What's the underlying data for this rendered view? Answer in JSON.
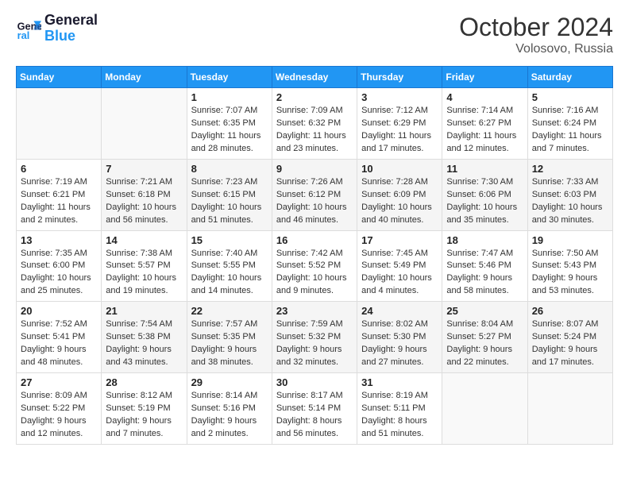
{
  "header": {
    "logo_line1": "General",
    "logo_line2": "Blue",
    "month": "October 2024",
    "location": "Volosovo, Russia"
  },
  "days_of_week": [
    "Sunday",
    "Monday",
    "Tuesday",
    "Wednesday",
    "Thursday",
    "Friday",
    "Saturday"
  ],
  "weeks": [
    {
      "days": [
        {
          "num": "",
          "info": ""
        },
        {
          "num": "",
          "info": ""
        },
        {
          "num": "1",
          "info": "Sunrise: 7:07 AM\nSunset: 6:35 PM\nDaylight: 11 hours and 28 minutes."
        },
        {
          "num": "2",
          "info": "Sunrise: 7:09 AM\nSunset: 6:32 PM\nDaylight: 11 hours and 23 minutes."
        },
        {
          "num": "3",
          "info": "Sunrise: 7:12 AM\nSunset: 6:29 PM\nDaylight: 11 hours and 17 minutes."
        },
        {
          "num": "4",
          "info": "Sunrise: 7:14 AM\nSunset: 6:27 PM\nDaylight: 11 hours and 12 minutes."
        },
        {
          "num": "5",
          "info": "Sunrise: 7:16 AM\nSunset: 6:24 PM\nDaylight: 11 hours and 7 minutes."
        }
      ]
    },
    {
      "days": [
        {
          "num": "6",
          "info": "Sunrise: 7:19 AM\nSunset: 6:21 PM\nDaylight: 11 hours and 2 minutes."
        },
        {
          "num": "7",
          "info": "Sunrise: 7:21 AM\nSunset: 6:18 PM\nDaylight: 10 hours and 56 minutes."
        },
        {
          "num": "8",
          "info": "Sunrise: 7:23 AM\nSunset: 6:15 PM\nDaylight: 10 hours and 51 minutes."
        },
        {
          "num": "9",
          "info": "Sunrise: 7:26 AM\nSunset: 6:12 PM\nDaylight: 10 hours and 46 minutes."
        },
        {
          "num": "10",
          "info": "Sunrise: 7:28 AM\nSunset: 6:09 PM\nDaylight: 10 hours and 40 minutes."
        },
        {
          "num": "11",
          "info": "Sunrise: 7:30 AM\nSunset: 6:06 PM\nDaylight: 10 hours and 35 minutes."
        },
        {
          "num": "12",
          "info": "Sunrise: 7:33 AM\nSunset: 6:03 PM\nDaylight: 10 hours and 30 minutes."
        }
      ]
    },
    {
      "days": [
        {
          "num": "13",
          "info": "Sunrise: 7:35 AM\nSunset: 6:00 PM\nDaylight: 10 hours and 25 minutes."
        },
        {
          "num": "14",
          "info": "Sunrise: 7:38 AM\nSunset: 5:57 PM\nDaylight: 10 hours and 19 minutes."
        },
        {
          "num": "15",
          "info": "Sunrise: 7:40 AM\nSunset: 5:55 PM\nDaylight: 10 hours and 14 minutes."
        },
        {
          "num": "16",
          "info": "Sunrise: 7:42 AM\nSunset: 5:52 PM\nDaylight: 10 hours and 9 minutes."
        },
        {
          "num": "17",
          "info": "Sunrise: 7:45 AM\nSunset: 5:49 PM\nDaylight: 10 hours and 4 minutes."
        },
        {
          "num": "18",
          "info": "Sunrise: 7:47 AM\nSunset: 5:46 PM\nDaylight: 9 hours and 58 minutes."
        },
        {
          "num": "19",
          "info": "Sunrise: 7:50 AM\nSunset: 5:43 PM\nDaylight: 9 hours and 53 minutes."
        }
      ]
    },
    {
      "days": [
        {
          "num": "20",
          "info": "Sunrise: 7:52 AM\nSunset: 5:41 PM\nDaylight: 9 hours and 48 minutes."
        },
        {
          "num": "21",
          "info": "Sunrise: 7:54 AM\nSunset: 5:38 PM\nDaylight: 9 hours and 43 minutes."
        },
        {
          "num": "22",
          "info": "Sunrise: 7:57 AM\nSunset: 5:35 PM\nDaylight: 9 hours and 38 minutes."
        },
        {
          "num": "23",
          "info": "Sunrise: 7:59 AM\nSunset: 5:32 PM\nDaylight: 9 hours and 32 minutes."
        },
        {
          "num": "24",
          "info": "Sunrise: 8:02 AM\nSunset: 5:30 PM\nDaylight: 9 hours and 27 minutes."
        },
        {
          "num": "25",
          "info": "Sunrise: 8:04 AM\nSunset: 5:27 PM\nDaylight: 9 hours and 22 minutes."
        },
        {
          "num": "26",
          "info": "Sunrise: 8:07 AM\nSunset: 5:24 PM\nDaylight: 9 hours and 17 minutes."
        }
      ]
    },
    {
      "days": [
        {
          "num": "27",
          "info": "Sunrise: 8:09 AM\nSunset: 5:22 PM\nDaylight: 9 hours and 12 minutes."
        },
        {
          "num": "28",
          "info": "Sunrise: 8:12 AM\nSunset: 5:19 PM\nDaylight: 9 hours and 7 minutes."
        },
        {
          "num": "29",
          "info": "Sunrise: 8:14 AM\nSunset: 5:16 PM\nDaylight: 9 hours and 2 minutes."
        },
        {
          "num": "30",
          "info": "Sunrise: 8:17 AM\nSunset: 5:14 PM\nDaylight: 8 hours and 56 minutes."
        },
        {
          "num": "31",
          "info": "Sunrise: 8:19 AM\nSunset: 5:11 PM\nDaylight: 8 hours and 51 minutes."
        },
        {
          "num": "",
          "info": ""
        },
        {
          "num": "",
          "info": ""
        }
      ]
    }
  ]
}
